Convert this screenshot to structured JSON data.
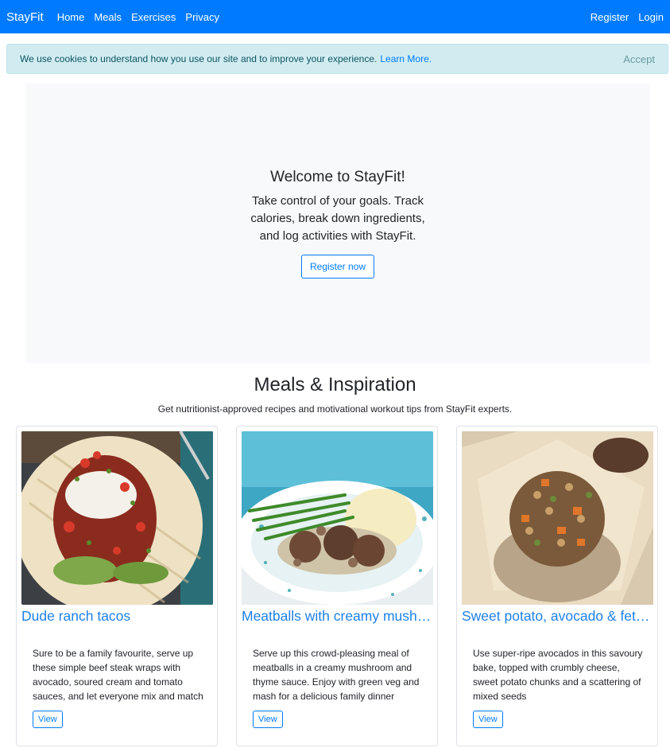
{
  "nav": {
    "brand": "StayFit",
    "links": [
      "Home",
      "Meals",
      "Exercises",
      "Privacy"
    ],
    "right_links": [
      "Register",
      "Login"
    ]
  },
  "cookie": {
    "text": "We use cookies to understand how you use our site and to improve your experience.",
    "link": "Learn More.",
    "accept": "Accept"
  },
  "hero": {
    "title": "Welcome to StayFit!",
    "text": "Take control of your goals. Track calories, break down ingredients, and log activities with StayFit.",
    "button": "Register now"
  },
  "section": {
    "title": "Meals & Inspiration",
    "subtitle": "Get nutritionist-approved recipes and motivational workout tips from StayFit experts."
  },
  "cards": [
    {
      "title": "Dude ranch tacos",
      "desc": "Sure to be a family favourite, serve up these simple beef steak wraps with avocado, soured cream and tomato sauces, and let everyone mix and match",
      "button": "View",
      "image": "taco-photo"
    },
    {
      "title": "Meatballs with creamy mushroom sauce",
      "desc": "Serve up this crowd-pleasing meal of meatballs in a creamy mushroom and thyme sauce. Enjoy with green veg and mash for a delicious family dinner",
      "button": "View",
      "image": "meatballs-photo"
    },
    {
      "title": "Sweet potato, avocado & feta muffins",
      "desc": "Use super-ripe avocados in this savoury bake, topped with crumbly cheese, sweet potato chunks and a scattering of mixed seeds",
      "button": "View",
      "image": "muffin-photo"
    }
  ],
  "colors": {
    "primary": "#007bff",
    "cookie_bg": "#d1ecf1",
    "hero_bg": "#f8f9fa"
  }
}
